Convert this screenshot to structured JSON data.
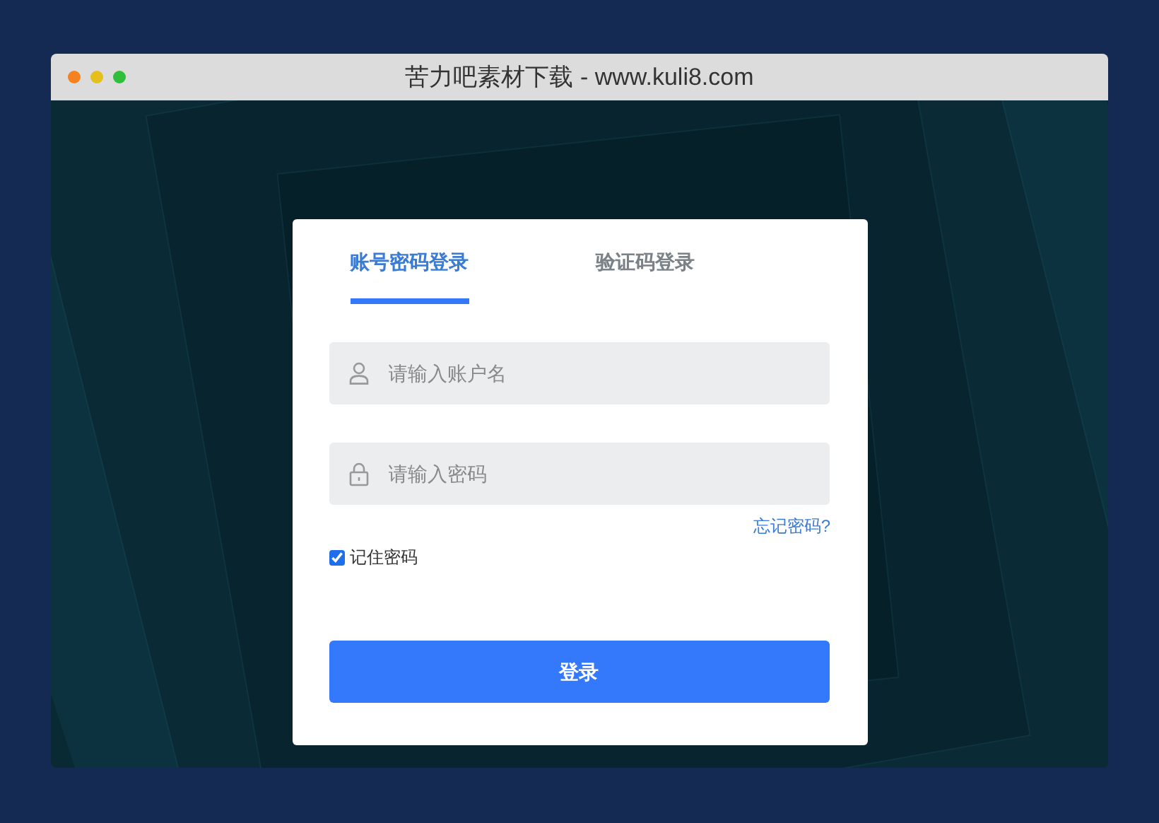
{
  "window": {
    "title": "苦力吧素材下载 - www.kuli8.com"
  },
  "tabs": [
    {
      "label": "账号密码登录",
      "selected": true
    },
    {
      "label": "验证码登录",
      "selected": false
    }
  ],
  "fields": [
    {
      "kind": "user",
      "placeholder": "请输入账户名"
    },
    {
      "kind": "lock",
      "placeholder": "请输入密码"
    }
  ],
  "forgot_link": "忘记密码?",
  "remember": {
    "label": "记住密码",
    "checked": true
  },
  "login_button": "登录"
}
